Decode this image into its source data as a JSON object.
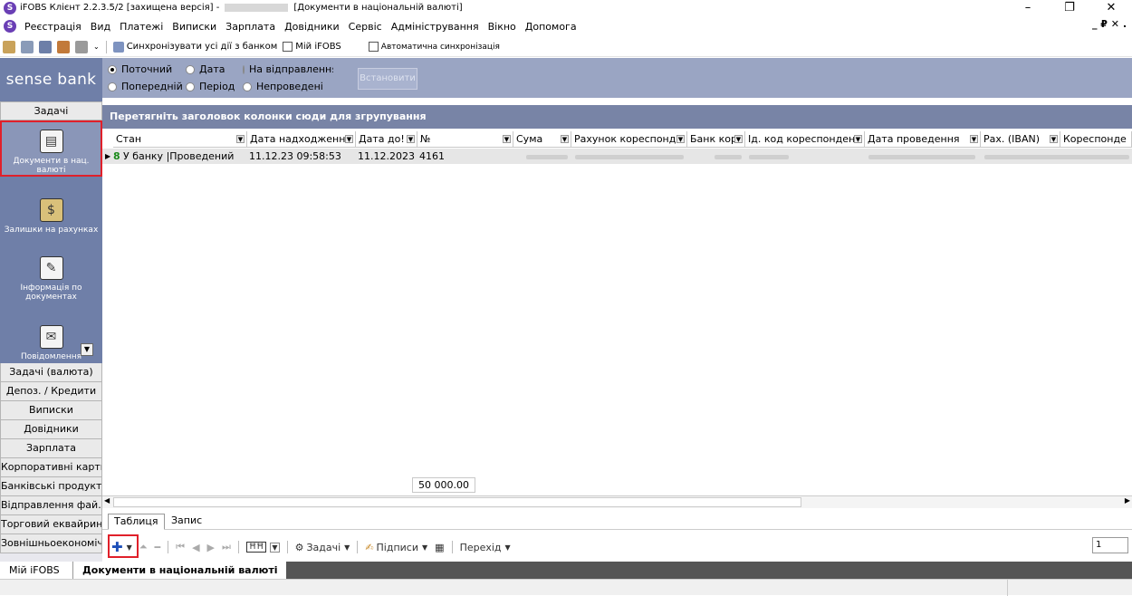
{
  "window": {
    "title_prefix": "iFOBS Клієнт 2.2.3.5/2 [захищена версія] - ",
    "title_doc": "[Документи в національній валюті]",
    "minimize": "–",
    "maximize": "❐",
    "close": "✕"
  },
  "menu": [
    "Реєстрація",
    "Вид",
    "Платежі",
    "Виписки",
    "Зарплата",
    "Довідники",
    "Сервіс",
    "Адміністрування",
    "Вікно",
    "Допомога"
  ],
  "mdi_controls": "_ ₽ ✕ .",
  "toolbar": {
    "sync_label": "Синхронізувати усі дії з банком",
    "my_ifobs": "Мій iFOBS",
    "auto_sync": "Автоматична синхронізація"
  },
  "sidebar": {
    "brand": "sense bank",
    "header": "Задачі",
    "tasks": [
      {
        "label": "Документи в нац. валюті",
        "icon": "documents-icon"
      },
      {
        "label": "Залишки на рахунках",
        "icon": "coins-icon"
      },
      {
        "label": "Інформація по документах",
        "icon": "info-docs-icon"
      },
      {
        "label": "Повідомлення",
        "icon": "messages-icon"
      }
    ],
    "sections": [
      "Задачі (валюта)",
      "Депоз. / Кредити",
      "Виписки",
      "Довідники",
      "Зарплата",
      "Корпоративні карти",
      "Банківські продукти",
      "Відправлення фай...",
      "Торговий еквайринг",
      "Зовнішньоекономічні"
    ]
  },
  "filter": {
    "radios": [
      {
        "label": "Поточний",
        "checked": true
      },
      {
        "label": "Дата",
        "checked": false
      },
      {
        "label": "На відправлення",
        "checked": false
      },
      {
        "label": "Попередній",
        "checked": false
      },
      {
        "label": "Період",
        "checked": false
      },
      {
        "label": "Непроведені",
        "checked": false
      }
    ],
    "set_button": "Встановити"
  },
  "group_bar": "Перетягніть заголовок колонки сюди для згрупування",
  "grid": {
    "columns": [
      "Стан",
      "Дата надходженн:",
      "Дата до!",
      "№",
      "Сума",
      "Рахунок кореспонде",
      "Банк кор",
      "Ід. код кореспондент",
      "Дата проведення",
      "Рах. (IBAN)",
      "Кореспонде"
    ],
    "row": {
      "status": "У банку |Проведений",
      "received": "11.12.23 09:58:53",
      "doc_date": "11.12.2023",
      "number": "4161"
    },
    "total": "50 000.00"
  },
  "tabs": [
    "Таблиця",
    "Запис"
  ],
  "toolbar2": {
    "tasks": "Задачі",
    "signatures": "Підписи",
    "transition": "Перехід",
    "page": "1"
  },
  "bottom_tabs": [
    "Мій iFOBS",
    "Документи в національній валюті"
  ]
}
